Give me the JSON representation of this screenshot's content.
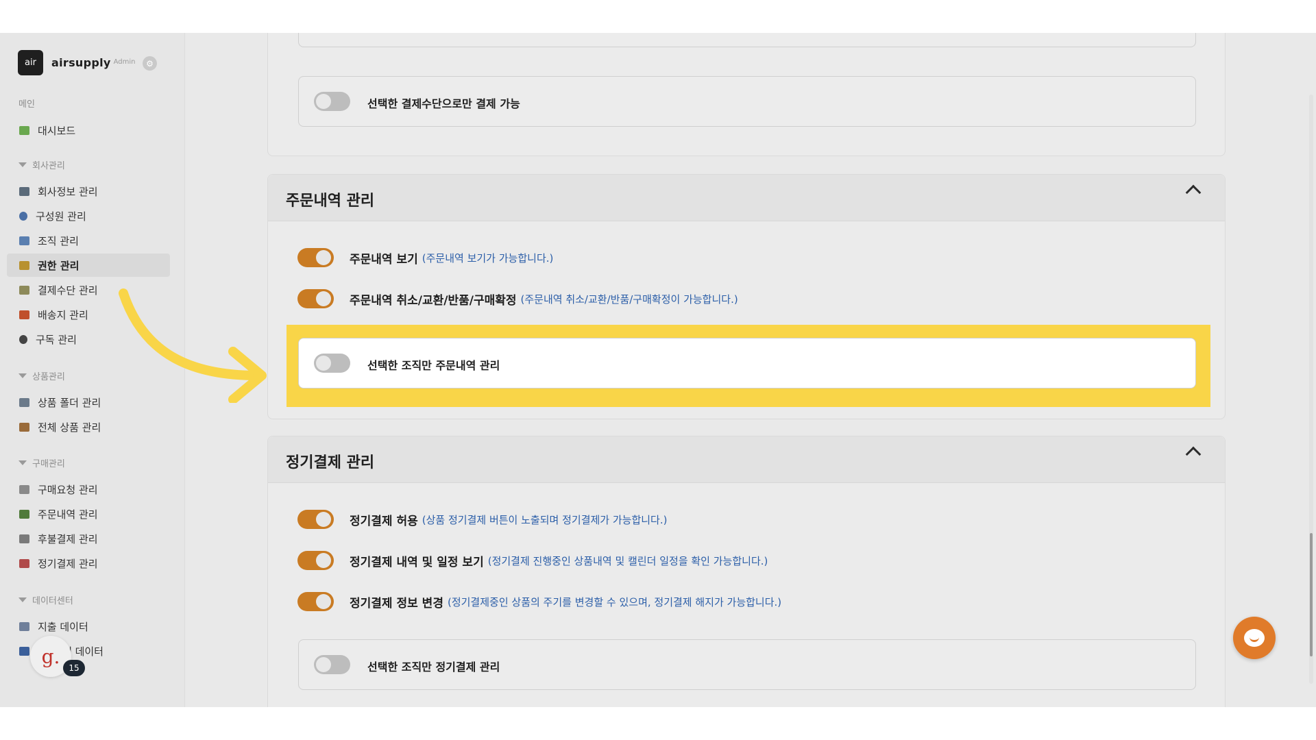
{
  "brand": {
    "logo_text": "air",
    "name": "airsupply",
    "sub": "Admin"
  },
  "sidebar": {
    "main_header": "메인",
    "dashboard": "대시보드",
    "groups": [
      {
        "label": "회사관리",
        "items": [
          "회사정보 관리",
          "구성원 관리",
          "조직 관리",
          "권한 관리",
          "결제수단 관리",
          "배송지 관리",
          "구독 관리"
        ]
      },
      {
        "label": "상품관리",
        "items": [
          "상품 폴더 관리",
          "전체 상품 관리"
        ]
      },
      {
        "label": "구매관리",
        "items": [
          "구매요청 관리",
          "주문내역 관리",
          "후불결제 관리",
          "정기결제 관리"
        ]
      },
      {
        "label": "데이터센터",
        "items": [
          "지출 데이터",
          "내 데이터"
        ]
      }
    ],
    "active_item": "권한 관리"
  },
  "user": {
    "avatar_letter": "g.",
    "badge_count": "15"
  },
  "top_card": {
    "option_label": "선택한 결제수단으로만 결제 가능"
  },
  "order_section": {
    "title": "주문내역 관리",
    "permissions": [
      {
        "label": "주문내역 보기",
        "desc": "(주문내역 보기가 가능합니다.)"
      },
      {
        "label": "주문내역 취소/교환/반품/구매확정",
        "desc": "(주문내역 취소/교환/반품/구매확정이 가능합니다.)"
      }
    ],
    "option_label": "선택한 조직만 주문내역 관리"
  },
  "subscription_section": {
    "title": "정기결제 관리",
    "permissions": [
      {
        "label": "정기결제 허용",
        "desc": "(상품 정기결제 버튼이 노출되며 정기결제가 가능합니다.)"
      },
      {
        "label": "정기결제 내역 및 일정 보기",
        "desc": "(정기결제 진행중인 상품내역 및 캘린더 일정을 확인 가능합니다.)"
      },
      {
        "label": "정기결제 정보 변경",
        "desc": "(정기결제중인 상품의 주기를 변경할 수 있으며, 정기결제 해지가 가능합니다.)"
      }
    ],
    "option_label": "선택한 조직만 정기결제 관리"
  },
  "colors": {
    "accent": "#c97b23",
    "highlight": "#f9d548",
    "desc_blue": "#2b5ea8",
    "chat": "#e07b2a"
  },
  "icons": [
    "gear-icon",
    "chevron-up-icon",
    "chat-icon",
    "arrow-annotation"
  ]
}
